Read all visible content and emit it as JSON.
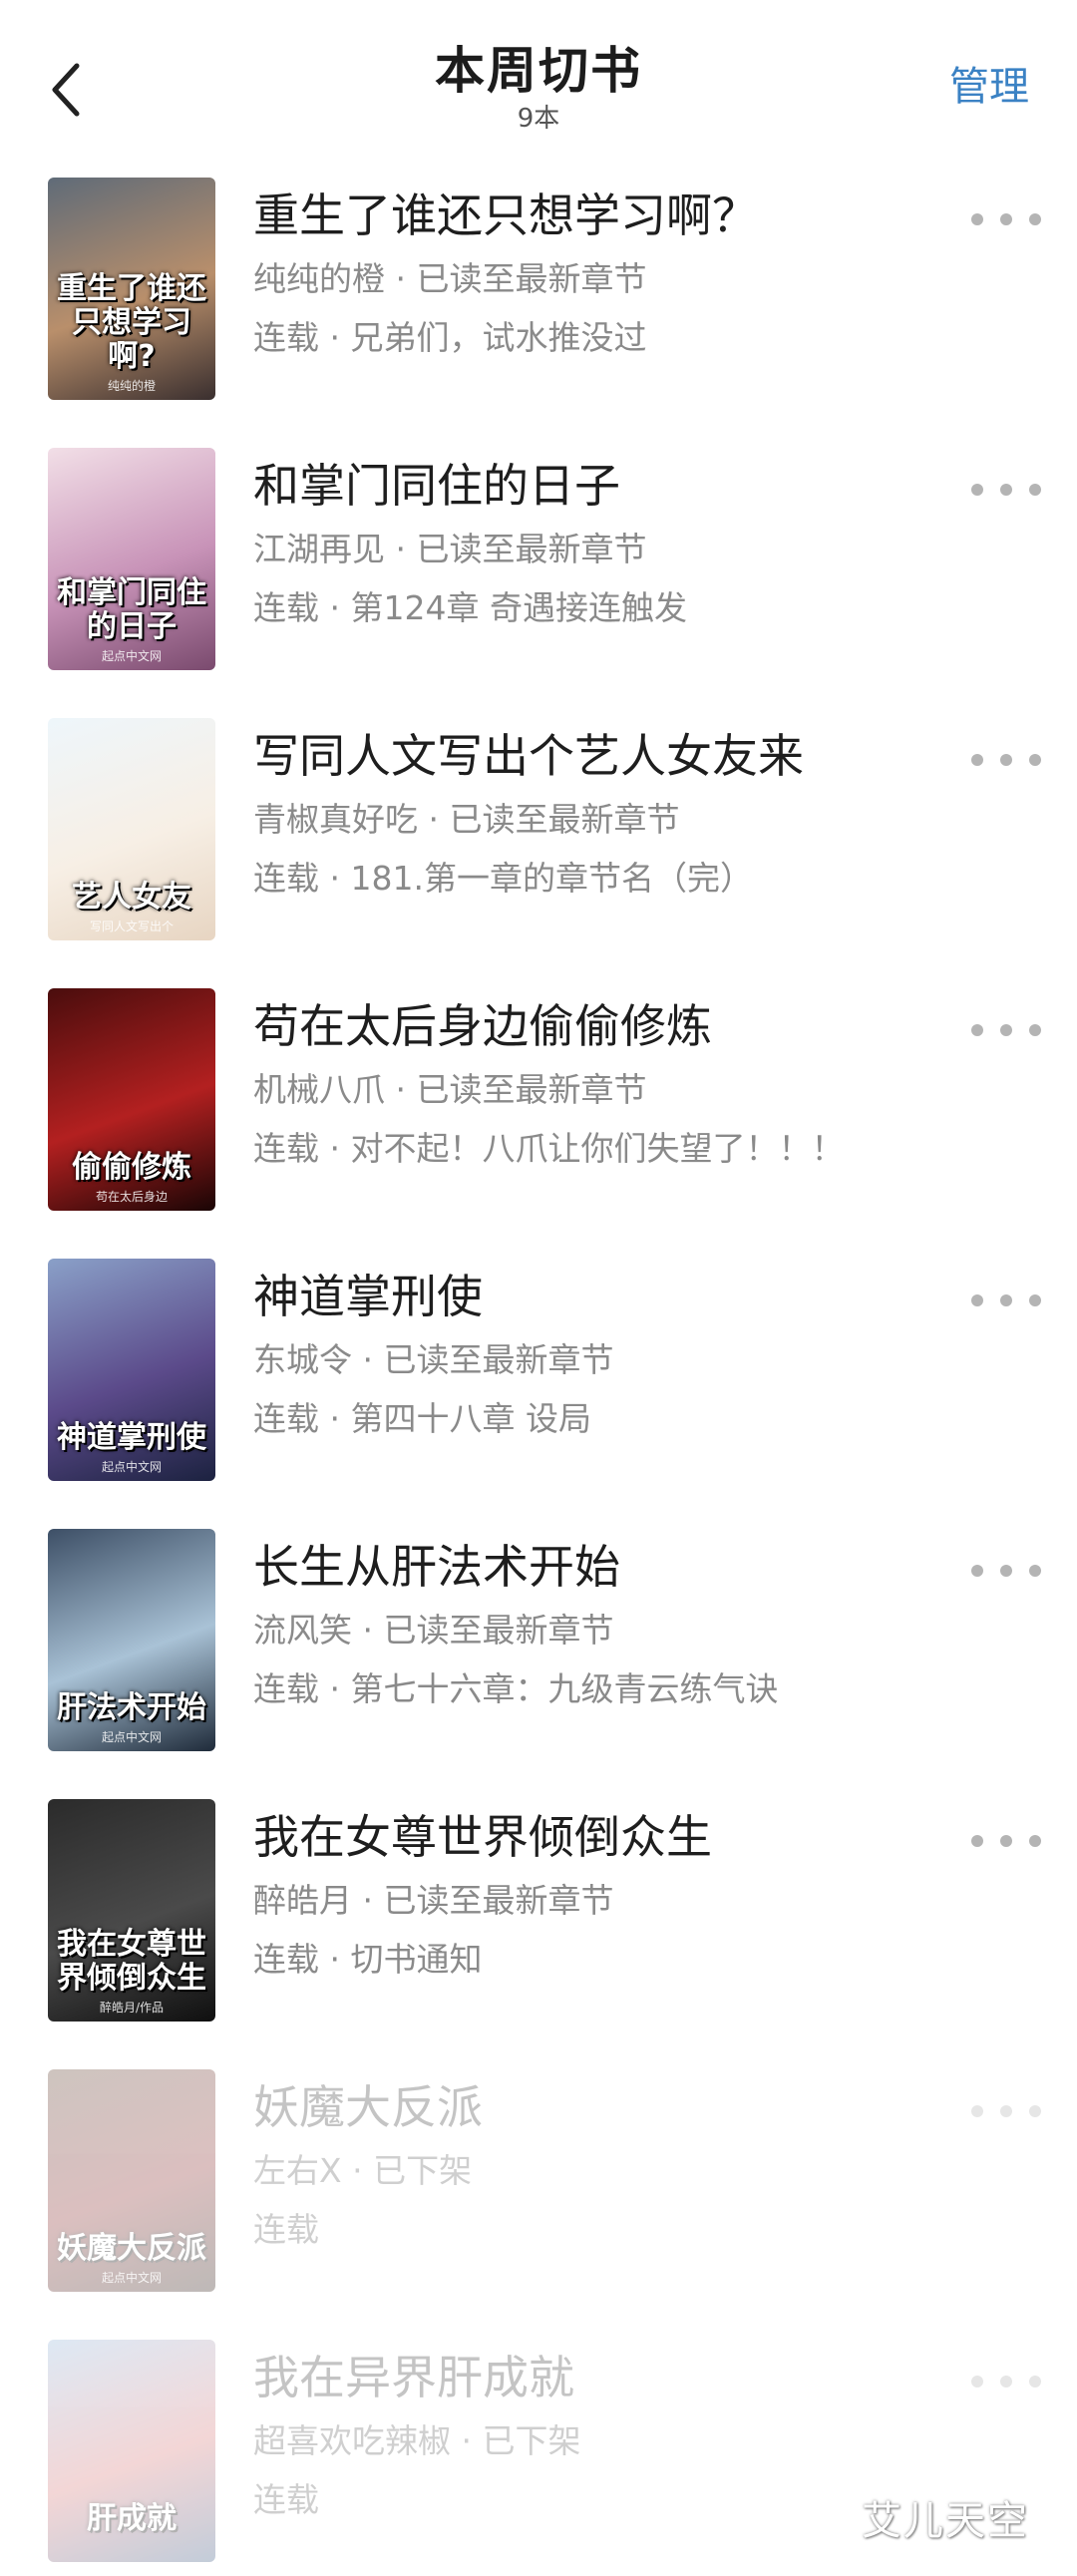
{
  "header": {
    "title": "本周切书",
    "count": "9本",
    "manage_label": "管理",
    "back_icon": "chevron-left-icon"
  },
  "books": [
    {
      "title": "重生了谁还只想学习啊？",
      "author_line": "纯纯的橙 · 已读至最新章节",
      "status_line": "连载 · 兄弟们，试水推没过",
      "cover_text": "重生了谁还只想学习啊?",
      "cover_publisher": "纯纯的橙",
      "cover_colors": [
        "#5f6b78",
        "#b98f6b",
        "#3a2f2f"
      ],
      "removed": false
    },
    {
      "title": "和掌门同住的日子",
      "author_line": "江湖再见 · 已读至最新章节",
      "status_line": "连载 · 第124章 奇遇接连触发",
      "cover_text": "和掌门同住的日子",
      "cover_publisher": "起点中文网",
      "cover_colors": [
        "#f2dfe7",
        "#c893b8",
        "#7a4a6e"
      ],
      "removed": false
    },
    {
      "title": "写同人文写出个艺人女友来",
      "author_line": "青椒真好吃 · 已读至最新章节",
      "status_line": "连载 · 181.第一章的章节名（完）",
      "cover_text": "艺人女友",
      "cover_publisher": "写同人文写出个",
      "cover_colors": [
        "#eef6fb",
        "#f7efe5",
        "#e7d5c2"
      ],
      "removed": false
    },
    {
      "title": "苟在太后身边偷偷修炼",
      "author_line": "机械八爪 · 已读至最新章节",
      "status_line": "连载 · 对不起！八爪让你们失望了！！！",
      "cover_text": "偷偷修炼",
      "cover_publisher": "苟在太后身边",
      "cover_colors": [
        "#4a0d0d",
        "#b32020",
        "#1a0505"
      ],
      "removed": false
    },
    {
      "title": "神道掌刑使",
      "author_line": "东城令 · 已读至最新章节",
      "status_line": "连载 · 第四十八章 设局",
      "cover_text": "神道掌刑使",
      "cover_publisher": "起点中文网",
      "cover_colors": [
        "#8aa0c8",
        "#5b4a8a",
        "#1c2240"
      ],
      "removed": false
    },
    {
      "title": "长生从肝法术开始",
      "author_line": "流风笑 · 已读至最新章节",
      "status_line": "连载 · 第七十六章：九级青云练气诀",
      "cover_text": "肝法术开始",
      "cover_publisher": "起点中文网",
      "cover_colors": [
        "#3d4f66",
        "#a9c2d6",
        "#1f2b3a"
      ],
      "removed": false
    },
    {
      "title": "我在女尊世界倾倒众生",
      "author_line": "醉皓月 · 已读至最新章节",
      "status_line": "连载 · 切书通知",
      "cover_text": "我在女尊世界倾倒众生",
      "cover_publisher": "醉皓月/作品",
      "cover_colors": [
        "#2b2b2b",
        "#4a4a4a",
        "#0f0f0f"
      ],
      "removed": false
    },
    {
      "title": "妖魔大反派",
      "author_line": "左右X · 已下架",
      "status_line": "连载",
      "cover_text": "妖魔大反派",
      "cover_publisher": "起点中文网",
      "cover_colors": [
        "#5a3a2a",
        "#8a2f2f",
        "#2a1a14"
      ],
      "removed": true
    },
    {
      "title": "我在异界肝成就",
      "author_line": "超喜欢吃辣椒 · 已下架",
      "status_line": "连载",
      "cover_text": "肝成就",
      "cover_publisher": "",
      "cover_colors": [
        "#8fb3d9",
        "#d97a7a",
        "#3b5a85"
      ],
      "removed": true
    }
  ],
  "more_icon": "more-horizontal-icon",
  "watermark": "艾儿天空"
}
